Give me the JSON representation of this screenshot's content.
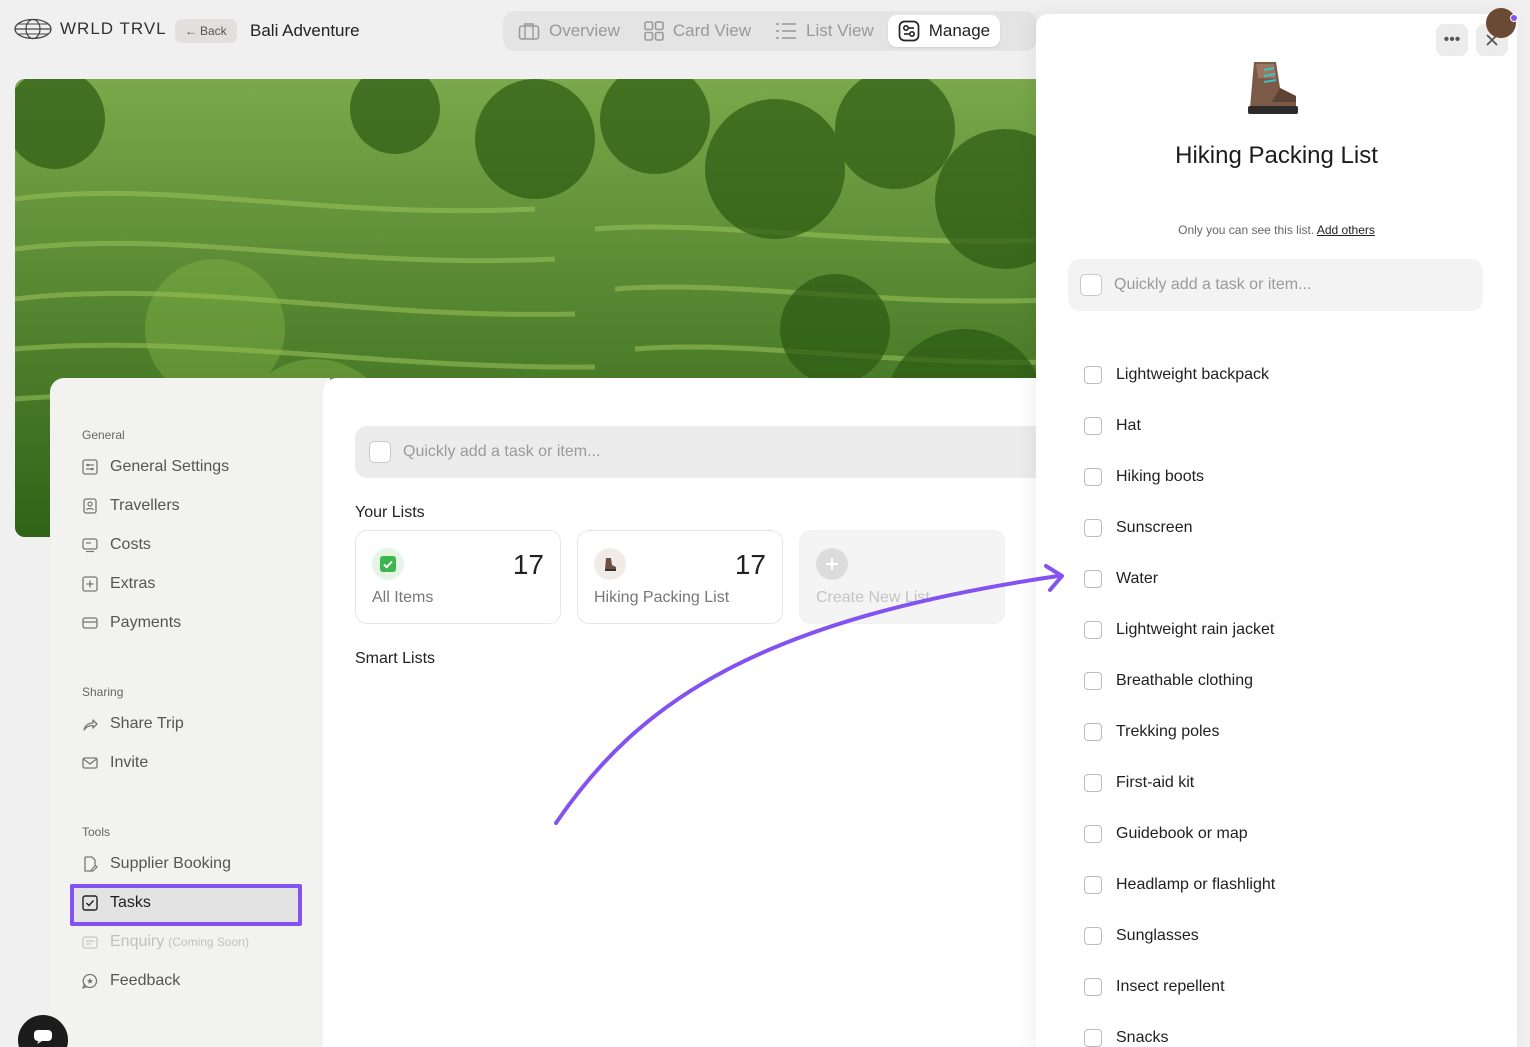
{
  "app": {
    "logo_text": "WRLD TRVL",
    "back_label": "Back",
    "trip_title": "Bali Adventure"
  },
  "view_tabs": [
    {
      "label": "Overview",
      "icon": "briefcase-icon"
    },
    {
      "label": "Card View",
      "icon": "grid-icon"
    },
    {
      "label": "List View",
      "icon": "list-icon"
    },
    {
      "label": "Manage",
      "icon": "manage-icon",
      "active": true
    }
  ],
  "sidebar": {
    "general_title": "General",
    "general": [
      {
        "label": "General Settings",
        "icon": "settings-icon"
      },
      {
        "label": "Travellers",
        "icon": "user-badge-icon"
      },
      {
        "label": "Costs",
        "icon": "receipt-icon"
      },
      {
        "label": "Extras",
        "icon": "add-box-icon"
      },
      {
        "label": "Payments",
        "icon": "card-icon"
      }
    ],
    "sharing_title": "Sharing",
    "sharing": [
      {
        "label": "Share Trip",
        "icon": "share-icon"
      },
      {
        "label": "Invite",
        "icon": "mail-icon"
      }
    ],
    "tools_title": "Tools",
    "tools": [
      {
        "label": "Supplier Booking",
        "icon": "booking-icon"
      },
      {
        "label": "Tasks",
        "icon": "checkbox-icon",
        "active": true
      },
      {
        "label": "Enquiry",
        "suffix": "(Coming Soon)",
        "icon": "enquiry-icon",
        "disabled": true
      },
      {
        "label": "Feedback",
        "icon": "feedback-icon"
      }
    ]
  },
  "main": {
    "quick_add_placeholder": "Quickly add a task or item...",
    "your_lists_title": "Your Lists",
    "lists": [
      {
        "name": "All Items",
        "count": "17",
        "icon": "check-icon"
      },
      {
        "name": "Hiking Packing List",
        "count": "17",
        "icon": "boot-icon"
      }
    ],
    "create_new_label": "Create New List",
    "smart_lists_title": "Smart Lists"
  },
  "panel": {
    "title": "Hiking Packing List",
    "privacy_text": "Only you can see this list.",
    "add_others": "Add others",
    "quick_add_placeholder": "Quickly add a task or item...",
    "tasks": [
      "Lightweight backpack",
      "Hat",
      "Hiking boots",
      "Sunscreen",
      "Water",
      "Lightweight rain jacket",
      "Breathable clothing",
      "Trekking poles",
      "First-aid kit",
      "Guidebook or map",
      "Headlamp or flashlight",
      "Sunglasses",
      "Insect repellent",
      "Snacks"
    ]
  },
  "colors": {
    "accent": "#8352f0",
    "check_green": "#3cb54a"
  }
}
